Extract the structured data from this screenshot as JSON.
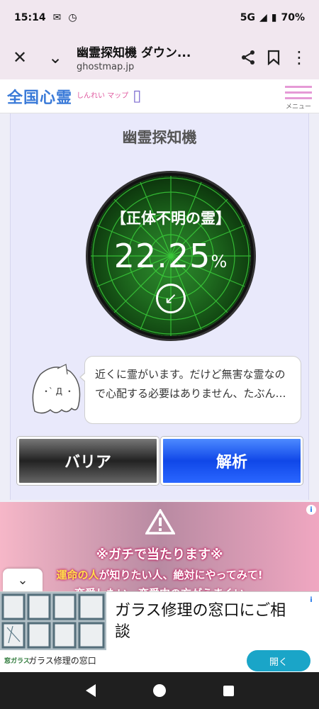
{
  "status": {
    "time": "15:14",
    "network": "5G",
    "battery": "70%"
  },
  "browser": {
    "title": "幽霊探知機 ダウン...",
    "url": "ghostmap.jp"
  },
  "site": {
    "logo_text": "全国心霊",
    "logo_sub": "しんれい マップ",
    "menu_label": "メニュー"
  },
  "detector": {
    "title": "幽霊探知機",
    "ghost_type": "【正体不明の霊】",
    "value": "22.25",
    "unit": "%",
    "message": "近くに霊がいます。だけど無害な霊なので心配する必要はありません、たぶん…",
    "barrier_label": "バリア",
    "analyze_label": "解析"
  },
  "ad1": {
    "headline": "※ガチで当たります※",
    "line_highlight": "運命の人",
    "line_rest": "が知りたい人、絶対にやってみて!",
    "line3": "恋愛したい、恋愛中の方がうまくい"
  },
  "ad2": {
    "text": "ガラス修理の窓口にご相談",
    "brand": "窓ガラス",
    "name": "ガラス修理の窓口",
    "open_label": "開く"
  },
  "colors": {
    "radar_green": "#2d8a2d",
    "barrier": "#333333",
    "analyze": "#1047e8",
    "open_button": "#1aa5c8"
  }
}
